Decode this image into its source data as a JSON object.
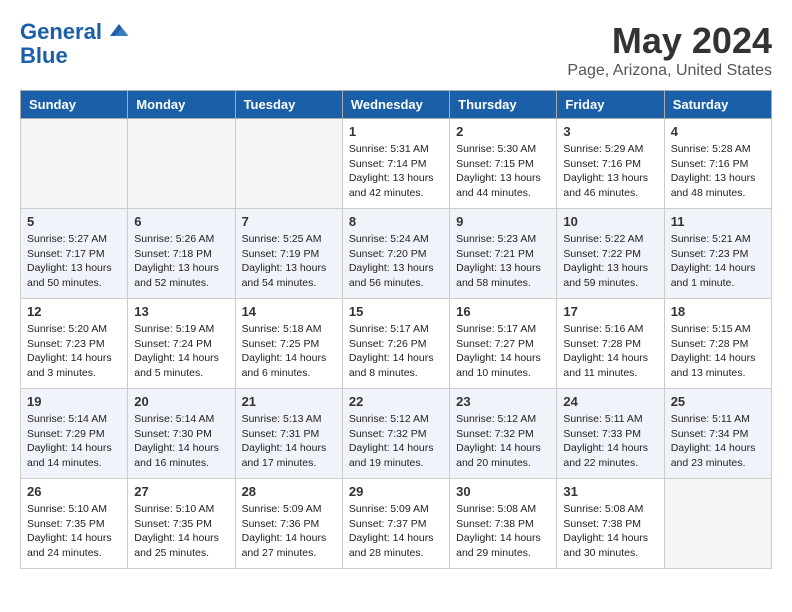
{
  "logo": {
    "line1": "General",
    "line2": "Blue"
  },
  "title": "May 2024",
  "location": "Page, Arizona, United States",
  "days_of_week": [
    "Sunday",
    "Monday",
    "Tuesday",
    "Wednesday",
    "Thursday",
    "Friday",
    "Saturday"
  ],
  "weeks": [
    [
      {
        "day": "",
        "sunrise": "",
        "sunset": "",
        "daylight": ""
      },
      {
        "day": "",
        "sunrise": "",
        "sunset": "",
        "daylight": ""
      },
      {
        "day": "",
        "sunrise": "",
        "sunset": "",
        "daylight": ""
      },
      {
        "day": "1",
        "sunrise": "Sunrise: 5:31 AM",
        "sunset": "Sunset: 7:14 PM",
        "daylight": "Daylight: 13 hours and 42 minutes."
      },
      {
        "day": "2",
        "sunrise": "Sunrise: 5:30 AM",
        "sunset": "Sunset: 7:15 PM",
        "daylight": "Daylight: 13 hours and 44 minutes."
      },
      {
        "day": "3",
        "sunrise": "Sunrise: 5:29 AM",
        "sunset": "Sunset: 7:16 PM",
        "daylight": "Daylight: 13 hours and 46 minutes."
      },
      {
        "day": "4",
        "sunrise": "Sunrise: 5:28 AM",
        "sunset": "Sunset: 7:16 PM",
        "daylight": "Daylight: 13 hours and 48 minutes."
      }
    ],
    [
      {
        "day": "5",
        "sunrise": "Sunrise: 5:27 AM",
        "sunset": "Sunset: 7:17 PM",
        "daylight": "Daylight: 13 hours and 50 minutes."
      },
      {
        "day": "6",
        "sunrise": "Sunrise: 5:26 AM",
        "sunset": "Sunset: 7:18 PM",
        "daylight": "Daylight: 13 hours and 52 minutes."
      },
      {
        "day": "7",
        "sunrise": "Sunrise: 5:25 AM",
        "sunset": "Sunset: 7:19 PM",
        "daylight": "Daylight: 13 hours and 54 minutes."
      },
      {
        "day": "8",
        "sunrise": "Sunrise: 5:24 AM",
        "sunset": "Sunset: 7:20 PM",
        "daylight": "Daylight: 13 hours and 56 minutes."
      },
      {
        "day": "9",
        "sunrise": "Sunrise: 5:23 AM",
        "sunset": "Sunset: 7:21 PM",
        "daylight": "Daylight: 13 hours and 58 minutes."
      },
      {
        "day": "10",
        "sunrise": "Sunrise: 5:22 AM",
        "sunset": "Sunset: 7:22 PM",
        "daylight": "Daylight: 13 hours and 59 minutes."
      },
      {
        "day": "11",
        "sunrise": "Sunrise: 5:21 AM",
        "sunset": "Sunset: 7:23 PM",
        "daylight": "Daylight: 14 hours and 1 minute."
      }
    ],
    [
      {
        "day": "12",
        "sunrise": "Sunrise: 5:20 AM",
        "sunset": "Sunset: 7:23 PM",
        "daylight": "Daylight: 14 hours and 3 minutes."
      },
      {
        "day": "13",
        "sunrise": "Sunrise: 5:19 AM",
        "sunset": "Sunset: 7:24 PM",
        "daylight": "Daylight: 14 hours and 5 minutes."
      },
      {
        "day": "14",
        "sunrise": "Sunrise: 5:18 AM",
        "sunset": "Sunset: 7:25 PM",
        "daylight": "Daylight: 14 hours and 6 minutes."
      },
      {
        "day": "15",
        "sunrise": "Sunrise: 5:17 AM",
        "sunset": "Sunset: 7:26 PM",
        "daylight": "Daylight: 14 hours and 8 minutes."
      },
      {
        "day": "16",
        "sunrise": "Sunrise: 5:17 AM",
        "sunset": "Sunset: 7:27 PM",
        "daylight": "Daylight: 14 hours and 10 minutes."
      },
      {
        "day": "17",
        "sunrise": "Sunrise: 5:16 AM",
        "sunset": "Sunset: 7:28 PM",
        "daylight": "Daylight: 14 hours and 11 minutes."
      },
      {
        "day": "18",
        "sunrise": "Sunrise: 5:15 AM",
        "sunset": "Sunset: 7:28 PM",
        "daylight": "Daylight: 14 hours and 13 minutes."
      }
    ],
    [
      {
        "day": "19",
        "sunrise": "Sunrise: 5:14 AM",
        "sunset": "Sunset: 7:29 PM",
        "daylight": "Daylight: 14 hours and 14 minutes."
      },
      {
        "day": "20",
        "sunrise": "Sunrise: 5:14 AM",
        "sunset": "Sunset: 7:30 PM",
        "daylight": "Daylight: 14 hours and 16 minutes."
      },
      {
        "day": "21",
        "sunrise": "Sunrise: 5:13 AM",
        "sunset": "Sunset: 7:31 PM",
        "daylight": "Daylight: 14 hours and 17 minutes."
      },
      {
        "day": "22",
        "sunrise": "Sunrise: 5:12 AM",
        "sunset": "Sunset: 7:32 PM",
        "daylight": "Daylight: 14 hours and 19 minutes."
      },
      {
        "day": "23",
        "sunrise": "Sunrise: 5:12 AM",
        "sunset": "Sunset: 7:32 PM",
        "daylight": "Daylight: 14 hours and 20 minutes."
      },
      {
        "day": "24",
        "sunrise": "Sunrise: 5:11 AM",
        "sunset": "Sunset: 7:33 PM",
        "daylight": "Daylight: 14 hours and 22 minutes."
      },
      {
        "day": "25",
        "sunrise": "Sunrise: 5:11 AM",
        "sunset": "Sunset: 7:34 PM",
        "daylight": "Daylight: 14 hours and 23 minutes."
      }
    ],
    [
      {
        "day": "26",
        "sunrise": "Sunrise: 5:10 AM",
        "sunset": "Sunset: 7:35 PM",
        "daylight": "Daylight: 14 hours and 24 minutes."
      },
      {
        "day": "27",
        "sunrise": "Sunrise: 5:10 AM",
        "sunset": "Sunset: 7:35 PM",
        "daylight": "Daylight: 14 hours and 25 minutes."
      },
      {
        "day": "28",
        "sunrise": "Sunrise: 5:09 AM",
        "sunset": "Sunset: 7:36 PM",
        "daylight": "Daylight: 14 hours and 27 minutes."
      },
      {
        "day": "29",
        "sunrise": "Sunrise: 5:09 AM",
        "sunset": "Sunset: 7:37 PM",
        "daylight": "Daylight: 14 hours and 28 minutes."
      },
      {
        "day": "30",
        "sunrise": "Sunrise: 5:08 AM",
        "sunset": "Sunset: 7:38 PM",
        "daylight": "Daylight: 14 hours and 29 minutes."
      },
      {
        "day": "31",
        "sunrise": "Sunrise: 5:08 AM",
        "sunset": "Sunset: 7:38 PM",
        "daylight": "Daylight: 14 hours and 30 minutes."
      },
      {
        "day": "",
        "sunrise": "",
        "sunset": "",
        "daylight": ""
      }
    ]
  ]
}
